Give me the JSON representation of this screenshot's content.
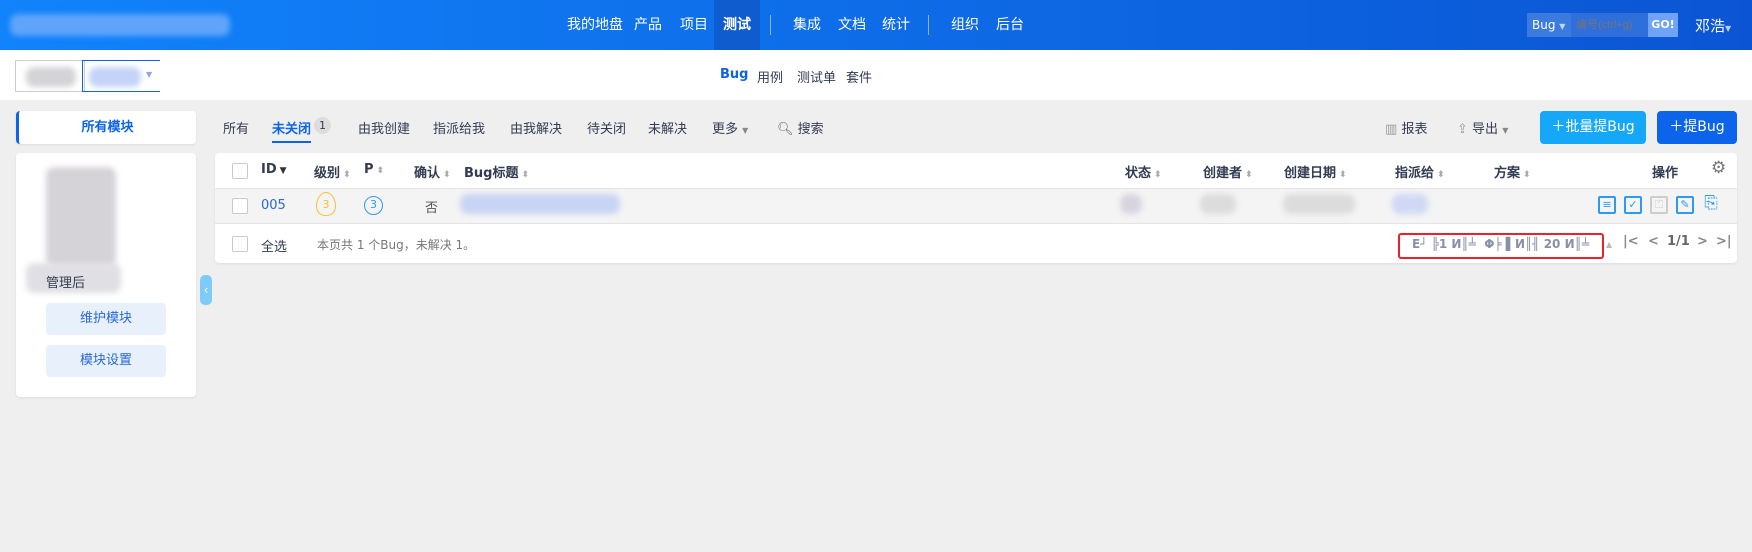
{
  "header": {
    "nav": [
      "我的地盘",
      "产品",
      "项目",
      "测试",
      "集成",
      "文档",
      "统计",
      "组织",
      "后台"
    ],
    "active": "测试",
    "search_type": "Bug",
    "search_placeholder": "编号(ctrl+g)",
    "go": "GO!",
    "user": "邓浩"
  },
  "subnav": {
    "items": [
      "Bug",
      "用例",
      "测试单",
      "套件"
    ],
    "active": "Bug"
  },
  "sidebar": {
    "title": "所有模块",
    "visible_item": "管理后",
    "buttons": [
      "维护模块",
      "模块设置"
    ]
  },
  "toolbar": {
    "tabs": [
      "所有",
      "未关闭",
      "由我创建",
      "指派给我",
      "由我解决",
      "待关闭",
      "未解决",
      "更多"
    ],
    "active": "未关闭",
    "badge": "1",
    "search": "搜索",
    "report": "报表",
    "export": "导出",
    "batch_create": "批量提Bug",
    "create": "提Bug"
  },
  "table": {
    "headers": [
      "ID",
      "级别",
      "P",
      "确认",
      "Bug标题",
      "状态",
      "创建者",
      "创建日期",
      "指派给",
      "方案",
      "操作"
    ],
    "rows": [
      {
        "id": "005",
        "severity": "3",
        "priority": "3",
        "confirmed": "否"
      }
    ],
    "select_all": "全选",
    "summary": "本页共 1 个Bug，未解决 1。"
  },
  "pager": {
    "garbled": "E┘ ╠1 И║╧  Φ╞ ▌И║╢ 20 И║╧",
    "page": "1/1"
  },
  "colors": {
    "accent": "#0c64eb",
    "nav": "#1183fb"
  }
}
